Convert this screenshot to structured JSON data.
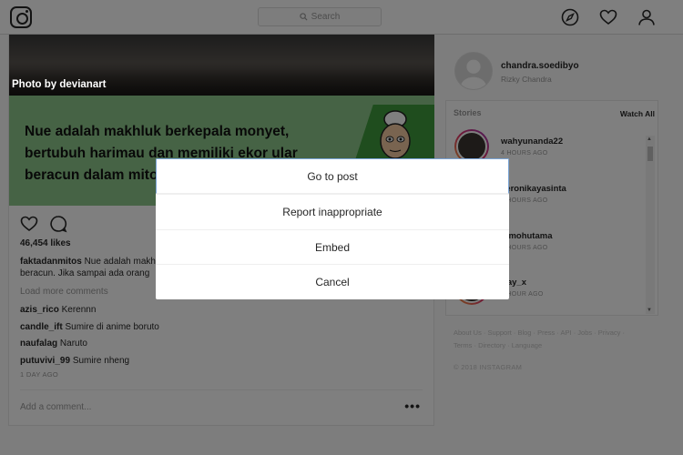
{
  "topbar": {
    "search_placeholder": "Search",
    "icons": [
      "instagram-logo-icon",
      "search-icon",
      "compass-icon",
      "heart-icon",
      "profile-icon"
    ]
  },
  "post": {
    "photo_credit": "Photo by devianart",
    "image_text": "Nue adalah makhluk berkepala monyet, bertubuh harimau dan memiliki ekor ular beracun dalam mitologi Jepang.",
    "likes": "46,454 likes",
    "caption_user": "faktadanmitos",
    "caption_text": "Nue adalah makhluk berkepala monyet, bertubuh harimau dan memiliki ekor Ular beracun. Jika sampai ada orang",
    "load_more": "Load more comments",
    "comments": [
      {
        "user": "azis_rico",
        "text": "Kerennn"
      },
      {
        "user": "candle_ift",
        "text": "Sumire di anime boruto"
      },
      {
        "user": "naufalag",
        "text": "Naruto"
      },
      {
        "user": "putuvivi_99",
        "text": "Sumire nheng"
      }
    ],
    "time": "1 DAY AGO",
    "add_comment_placeholder": "Add a comment...",
    "more_label": "•••"
  },
  "sidebar": {
    "username": "chandra.soedibyo",
    "fullname": "Rizky Chandra",
    "stories_label": "Stories",
    "watch_all": "Watch All",
    "stories": [
      {
        "name": "wahyunanda22",
        "time": "4 HOURS AGO"
      },
      {
        "name": "veronikayasinta",
        "time": "4 HOURS AGO"
      },
      {
        "name": "dimohutama",
        "time": "5 HOURS AGO"
      },
      {
        "name": "fray_x",
        "time": "1 HOUR AGO"
      }
    ],
    "footer_links": "About Us · Support · Blog · Press · API · Jobs · Privacy · Terms · Directory · Language",
    "copyright": "© 2018 INSTAGRAM"
  },
  "dialog": {
    "items": [
      "Go to post",
      "Report inappropriate",
      "Embed",
      "Cancel"
    ]
  },
  "colors": {
    "overlay": "#808080",
    "dialog_focus_border": "#7aa4d6",
    "image_green": "#8dc78a"
  }
}
